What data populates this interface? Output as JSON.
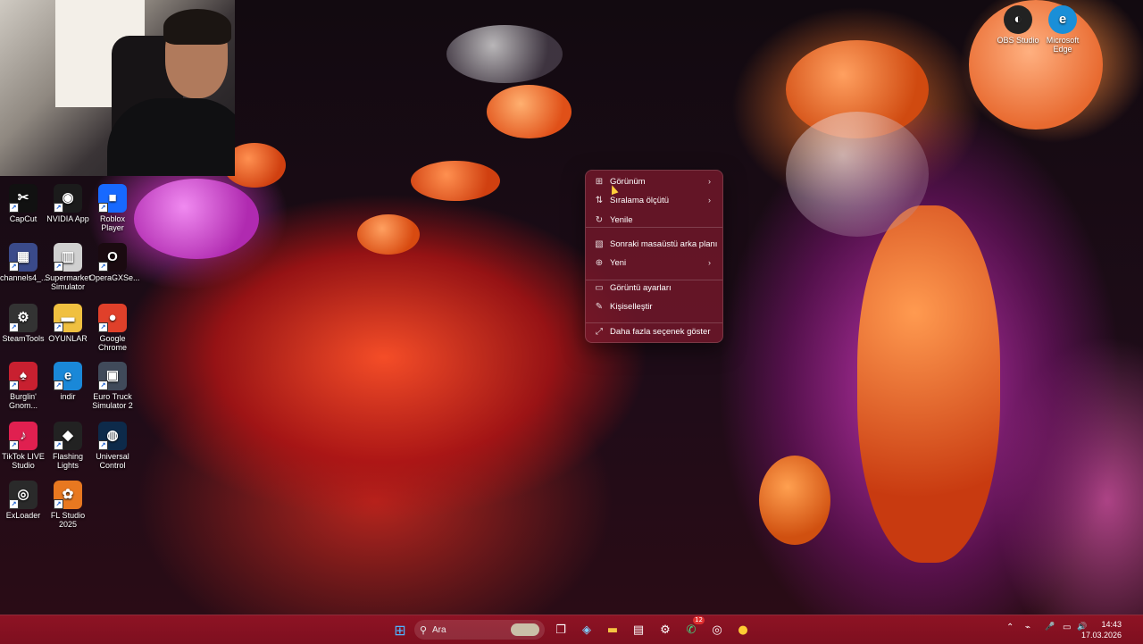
{
  "desktop": {
    "icons_left": [
      {
        "label": "CapCut",
        "glyph": "✂",
        "color": "#111111"
      },
      {
        "label": "NVIDIA App",
        "glyph": "◉",
        "color": "#1b1b1b"
      },
      {
        "label": "Roblox Player",
        "glyph": "■",
        "color": "#1769ff"
      },
      {
        "label": "channels4_...",
        "glyph": "▦",
        "color": "#3a4a8a"
      },
      {
        "label": "Supermarket Simulator",
        "glyph": "▥",
        "color": "#d0d0d0"
      },
      {
        "label": "OperaGXSe...",
        "glyph": "O",
        "color": "#1a0a10"
      },
      {
        "label": "SteamTools",
        "glyph": "⚙",
        "color": "#333333"
      },
      {
        "label": "OYUNLAR",
        "glyph": "▬",
        "color": "#f0c040"
      },
      {
        "label": "Google Chrome",
        "glyph": "●",
        "color": "#e0402a"
      },
      {
        "label": "Burglin' Gnom...",
        "glyph": "♠",
        "color": "#c82030"
      },
      {
        "label": "indir",
        "glyph": "e",
        "color": "#1a88d8"
      },
      {
        "label": "Euro Truck Simulator 2",
        "glyph": "▣",
        "color": "#404a5a"
      },
      {
        "label": "TikTok LIVE Studio",
        "glyph": "♪",
        "color": "#e02050"
      },
      {
        "label": "Flashing Lights",
        "glyph": "◆",
        "color": "#222222"
      },
      {
        "label": "Universal Control",
        "glyph": "◍",
        "color": "#0d2a4a"
      },
      {
        "label": "ExLoader",
        "glyph": "◎",
        "color": "#2a2a2a"
      },
      {
        "label": "FL Studio 2025",
        "glyph": "✿",
        "color": "#e87820"
      }
    ],
    "icons_right": [
      {
        "label": "OBS Studio",
        "glyph": "◐",
        "color": "#222222"
      },
      {
        "label": "Microsoft Edge",
        "glyph": "e",
        "color": "#1a8fd8"
      }
    ]
  },
  "context_menu": {
    "items": [
      {
        "label": "Görünüm",
        "icon": "grid-icon",
        "glyph": "⊞",
        "submenu": true
      },
      {
        "label": "Sıralama ölçütü",
        "icon": "sort-icon",
        "glyph": "⇅",
        "submenu": true
      },
      {
        "label": "Yenile",
        "icon": "refresh-icon",
        "glyph": "↻",
        "submenu": false
      },
      {
        "label": "Sonraki masaüstü arka planı",
        "icon": "wallpaper-icon",
        "glyph": "▧",
        "submenu": false
      },
      {
        "label": "Yeni",
        "icon": "new-icon",
        "glyph": "⊕",
        "submenu": true
      },
      {
        "label": "Görüntü ayarları",
        "icon": "display-icon",
        "glyph": "▭",
        "submenu": false
      },
      {
        "label": "Kişiselleştir",
        "icon": "pen-icon",
        "glyph": "✎",
        "submenu": false
      },
      {
        "label": "Daha fazla seçenek göster",
        "icon": "expand-icon",
        "glyph": "⤢",
        "submenu": false
      }
    ],
    "submenu_arrow": "›"
  },
  "taskbar": {
    "start_glyph": "⊞",
    "search_placeholder": "Ara",
    "search_glyph": "⚲",
    "whatsapp_badge": "12",
    "apps": [
      {
        "name": "task-view",
        "glyph": "❐"
      },
      {
        "name": "m365",
        "glyph": "◈"
      },
      {
        "name": "file-explorer",
        "glyph": "▬"
      },
      {
        "name": "store",
        "glyph": "▤"
      },
      {
        "name": "settings",
        "glyph": "⚙"
      },
      {
        "name": "whatsapp",
        "glyph": "✆"
      },
      {
        "name": "steam",
        "glyph": "◎"
      },
      {
        "name": "chrome",
        "glyph": "●"
      }
    ],
    "tray": {
      "chevron": "⌃",
      "network": "⌁",
      "mic": "🎤",
      "monitor": "▭",
      "volume": "🔊"
    },
    "clock": {
      "time": "14:43",
      "date": "17.03.2026"
    }
  }
}
